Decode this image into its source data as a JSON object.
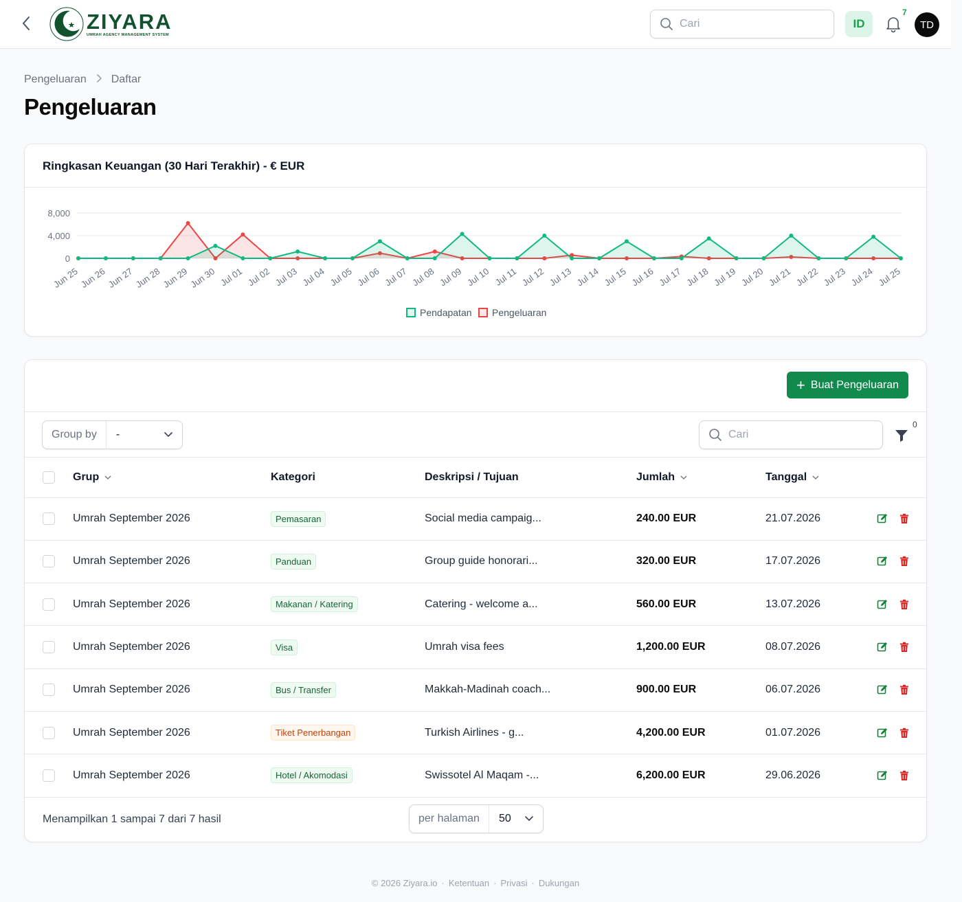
{
  "app": {
    "logo_name": "ZIYARA",
    "logo_tagline": "UMRAH AGENCY MANAGEMENT SYSTEM",
    "search_placeholder": "Cari",
    "lang": "ID",
    "notifications_count": "7",
    "avatar_initials": "TD"
  },
  "breadcrumb": {
    "parent": "Pengeluaran",
    "current": "Daftar"
  },
  "page_title": "Pengeluaran",
  "chart_card": {
    "title": "Ringkasan Keuangan (30 Hari Terakhir) - € EUR"
  },
  "chart_data": {
    "type": "area",
    "title": "Ringkasan Keuangan (30 Hari Terakhir) - € EUR",
    "categories": [
      "Jun 25",
      "Jun 26",
      "Jun 27",
      "Jun 28",
      "Jun 29",
      "Jun 30",
      "Jul 01",
      "Jul 02",
      "Jul 03",
      "Jul 04",
      "Jul 05",
      "Jul 06",
      "Jul 07",
      "Jul 08",
      "Jul 09",
      "Jul 10",
      "Jul 11",
      "Jul 12",
      "Jul 13",
      "Jul 14",
      "Jul 15",
      "Jul 16",
      "Jul 17",
      "Jul 18",
      "Jul 19",
      "Jul 20",
      "Jul 21",
      "Jul 22",
      "Jul 23",
      "Jul 24",
      "Jul 25"
    ],
    "series": [
      {
        "name": "Pendapatan",
        "color": "#10b981",
        "values": [
          0,
          0,
          0,
          0,
          0,
          2200,
          0,
          0,
          1200,
          0,
          0,
          3000,
          0,
          0,
          4300,
          0,
          0,
          4000,
          0,
          0,
          3000,
          0,
          0,
          3500,
          0,
          0,
          4000,
          0,
          0,
          3800,
          0
        ]
      },
      {
        "name": "Pengeluaran",
        "color": "#ef4444",
        "values": [
          0,
          0,
          0,
          0,
          6200,
          0,
          4200,
          0,
          0,
          0,
          0,
          900,
          0,
          1200,
          0,
          0,
          0,
          0,
          560,
          0,
          0,
          0,
          320,
          0,
          0,
          0,
          240,
          0,
          0,
          0,
          0
        ]
      }
    ],
    "yticks": [
      "8,000",
      "4,000",
      "0"
    ],
    "ylim": [
      0,
      8000
    ],
    "grid": true,
    "legend_position": "bottom"
  },
  "actions": {
    "create_label": "Buat Pengeluaran"
  },
  "toolbar": {
    "groupby_label": "Group by",
    "groupby_value": "-",
    "search_placeholder": "Cari",
    "filter_count": "0"
  },
  "table": {
    "headers": {
      "grup": "Grup",
      "kategori": "Kategori",
      "deskripsi": "Deskripsi / Tujuan",
      "jumlah": "Jumlah",
      "tanggal": "Tanggal"
    },
    "rows": [
      {
        "grup": "Umrah September 2026",
        "kategori": "Pemasaran",
        "kat_color": "green",
        "deskripsi": "Social media campaig...",
        "jumlah": "240.00 EUR",
        "tanggal": "21.07.2026"
      },
      {
        "grup": "Umrah September 2026",
        "kategori": "Panduan",
        "kat_color": "green",
        "deskripsi": "Group guide honorari...",
        "jumlah": "320.00 EUR",
        "tanggal": "17.07.2026"
      },
      {
        "grup": "Umrah September 2026",
        "kategori": "Makanan / Katering",
        "kat_color": "green",
        "deskripsi": "Catering - welcome a...",
        "jumlah": "560.00 EUR",
        "tanggal": "13.07.2026"
      },
      {
        "grup": "Umrah September 2026",
        "kategori": "Visa",
        "kat_color": "green",
        "deskripsi": "Umrah visa fees",
        "jumlah": "1,200.00 EUR",
        "tanggal": "08.07.2026"
      },
      {
        "grup": "Umrah September 2026",
        "kategori": "Bus / Transfer",
        "kat_color": "green",
        "deskripsi": "Makkah-Madinah coach...",
        "jumlah": "900.00 EUR",
        "tanggal": "06.07.2026"
      },
      {
        "grup": "Umrah September 2026",
        "kategori": "Tiket Penerbangan",
        "kat_color": "orange",
        "deskripsi": "Turkish Airlines - g...",
        "jumlah": "4,200.00 EUR",
        "tanggal": "01.07.2026"
      },
      {
        "grup": "Umrah September 2026",
        "kategori": "Hotel / Akomodasi",
        "kat_color": "green",
        "deskripsi": "Swissotel Al Maqam -...",
        "jumlah": "6,200.00 EUR",
        "tanggal": "29.06.2026"
      }
    ]
  },
  "pagination": {
    "showing": "Menampilkan 1 sampai 7 dari 7 hasil",
    "per_page_label": "per halaman",
    "per_page_value": "50"
  },
  "footer": {
    "copyright": "© 2026 Ziyara.io",
    "links": [
      "Ketentuan",
      "Privasi",
      "Dukungan"
    ]
  },
  "colors": {
    "brand": "#118a4d",
    "income": "#10b981",
    "expense": "#ef4444",
    "delete": "#dc2626"
  }
}
